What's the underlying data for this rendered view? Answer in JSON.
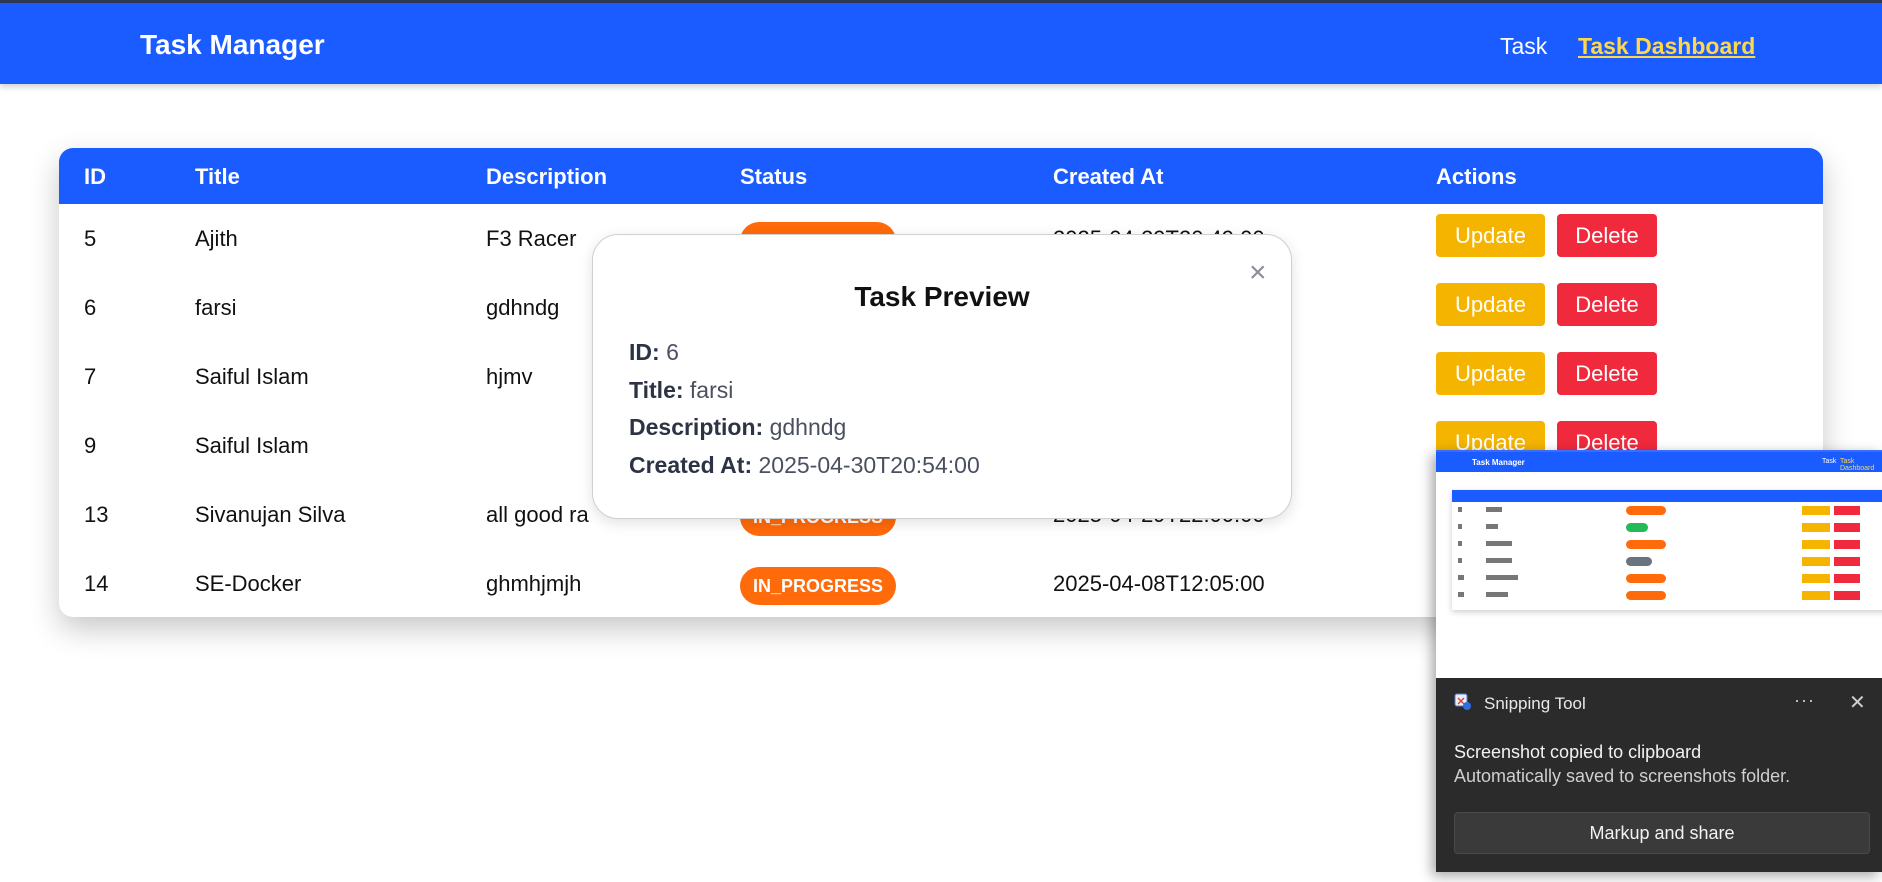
{
  "header": {
    "brand": "Task Manager",
    "nav": [
      {
        "label": "Task"
      },
      {
        "label": "Task Dashboard"
      }
    ]
  },
  "table": {
    "columns": [
      "ID",
      "Title",
      "Description",
      "Status",
      "Created At",
      "Actions"
    ],
    "update_label": "Update",
    "delete_label": "Delete",
    "rows": [
      {
        "id": "5",
        "title": "Ajith",
        "description": "F3 Racer",
        "status": "",
        "created_at": "2025-04-29T20:49:00"
      },
      {
        "id": "6",
        "title": "farsi",
        "description": "gdhndg",
        "status": "",
        "created_at": ""
      },
      {
        "id": "7",
        "title": "Saiful Islam",
        "description": "hjmv",
        "status": "",
        "created_at": ""
      },
      {
        "id": "9",
        "title": "Saiful Islam",
        "description": "",
        "status": "",
        "created_at": ""
      },
      {
        "id": "13",
        "title": "Sivanujan Silva",
        "description": "all good ra",
        "status": "IN_PROGRESS",
        "created_at": "2025-04-29T22:00:00"
      },
      {
        "id": "14",
        "title": "SE-Docker",
        "description": "ghmhjmjh",
        "status": "IN_PROGRESS",
        "created_at": "2025-04-08T12:05:00"
      }
    ]
  },
  "modal": {
    "title": "Task Preview",
    "close_symbol": "×",
    "id_label": "ID:",
    "id_value": "6",
    "title_label": "Title:",
    "title_value": "farsi",
    "description_label": "Description:",
    "description_value": "gdhndg",
    "created_label": "Created At:",
    "created_value": "2025-04-30T20:54:00"
  },
  "toast": {
    "app_name": "Snipping Tool",
    "more_symbol": "···",
    "close_symbol": "✕",
    "message": "Screenshot copied to clipboard",
    "submessage": "Automatically saved to screenshots folder.",
    "action_label": "Markup and share",
    "thumbnail": {
      "brand": "Task Manager",
      "nav_task": "Task",
      "nav_dashboard": "Task Dashboard"
    }
  },
  "colors": {
    "primary": "#1a5cff",
    "nav_active": "#ffd84a",
    "status_in_progress": "#ff6a0a",
    "update": "#f4b400",
    "delete": "#f02a3c",
    "toast_bg": "#2b2b2b"
  }
}
